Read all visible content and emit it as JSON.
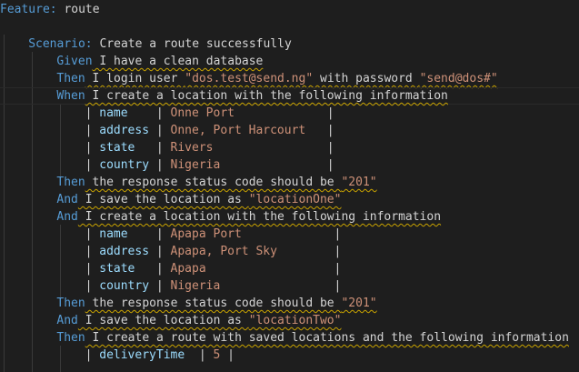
{
  "colors": {
    "background": "#1e1e1e",
    "keyword": "#569cd6",
    "text": "#d4d4d4",
    "string": "#ce9178",
    "squiggle": "#c9a300"
  },
  "lines": [
    {
      "indent": 0,
      "keyword": "Feature:",
      "kind": "feature",
      "text": " route"
    },
    {
      "indent": 0,
      "keyword": "",
      "kind": "blank",
      "text": ""
    },
    {
      "indent": 4,
      "keyword": "Scenario:",
      "kind": "scenario",
      "text": " Create a route successfully"
    },
    {
      "indent": 8,
      "keyword": "Given",
      "kind": "step",
      "text": " I have a clean database"
    },
    {
      "indent": 8,
      "keyword": "Then",
      "kind": "step",
      "text": " I login user \"dos.test@send.ng\" with password \"send@dos#\""
    },
    {
      "indent": 8,
      "keyword": "When",
      "kind": "step",
      "text": " I create a location with the following information",
      "current": true
    },
    {
      "indent": 12,
      "keyword": "",
      "kind": "table",
      "cells": [
        "name    ",
        "Onne Port             "
      ]
    },
    {
      "indent": 12,
      "keyword": "",
      "kind": "table",
      "cells": [
        "address ",
        "Onne, Port Harcourt   "
      ]
    },
    {
      "indent": 12,
      "keyword": "",
      "kind": "table",
      "cells": [
        "state   ",
        "Rivers                "
      ]
    },
    {
      "indent": 12,
      "keyword": "",
      "kind": "table",
      "cells": [
        "country ",
        "Nigeria               "
      ]
    },
    {
      "indent": 8,
      "keyword": "Then",
      "kind": "step",
      "text": " the response status code should be \"201\""
    },
    {
      "indent": 8,
      "keyword": "And",
      "kind": "step",
      "text": " I save the location as \"locationOne\""
    },
    {
      "indent": 8,
      "keyword": "And",
      "kind": "step",
      "text": " I create a location with the following information"
    },
    {
      "indent": 12,
      "keyword": "",
      "kind": "table",
      "cells": [
        "name    ",
        "Apapa Port             "
      ]
    },
    {
      "indent": 12,
      "keyword": "",
      "kind": "table",
      "cells": [
        "address ",
        "Apapa, Port Sky        "
      ]
    },
    {
      "indent": 12,
      "keyword": "",
      "kind": "table",
      "cells": [
        "state   ",
        "Apapa                  "
      ]
    },
    {
      "indent": 12,
      "keyword": "",
      "kind": "table",
      "cells": [
        "country ",
        "Nigeria                "
      ]
    },
    {
      "indent": 8,
      "keyword": "Then",
      "kind": "step",
      "text": " the response status code should be \"201\""
    },
    {
      "indent": 8,
      "keyword": "And",
      "kind": "step",
      "text": " I save the location as \"locationTwo\""
    },
    {
      "indent": 8,
      "keyword": "Then",
      "kind": "step",
      "text": " I create a route with saved locations and the following information"
    },
    {
      "indent": 12,
      "keyword": "",
      "kind": "table",
      "cells": [
        "deliveryTime  ",
        "5 "
      ]
    }
  ]
}
